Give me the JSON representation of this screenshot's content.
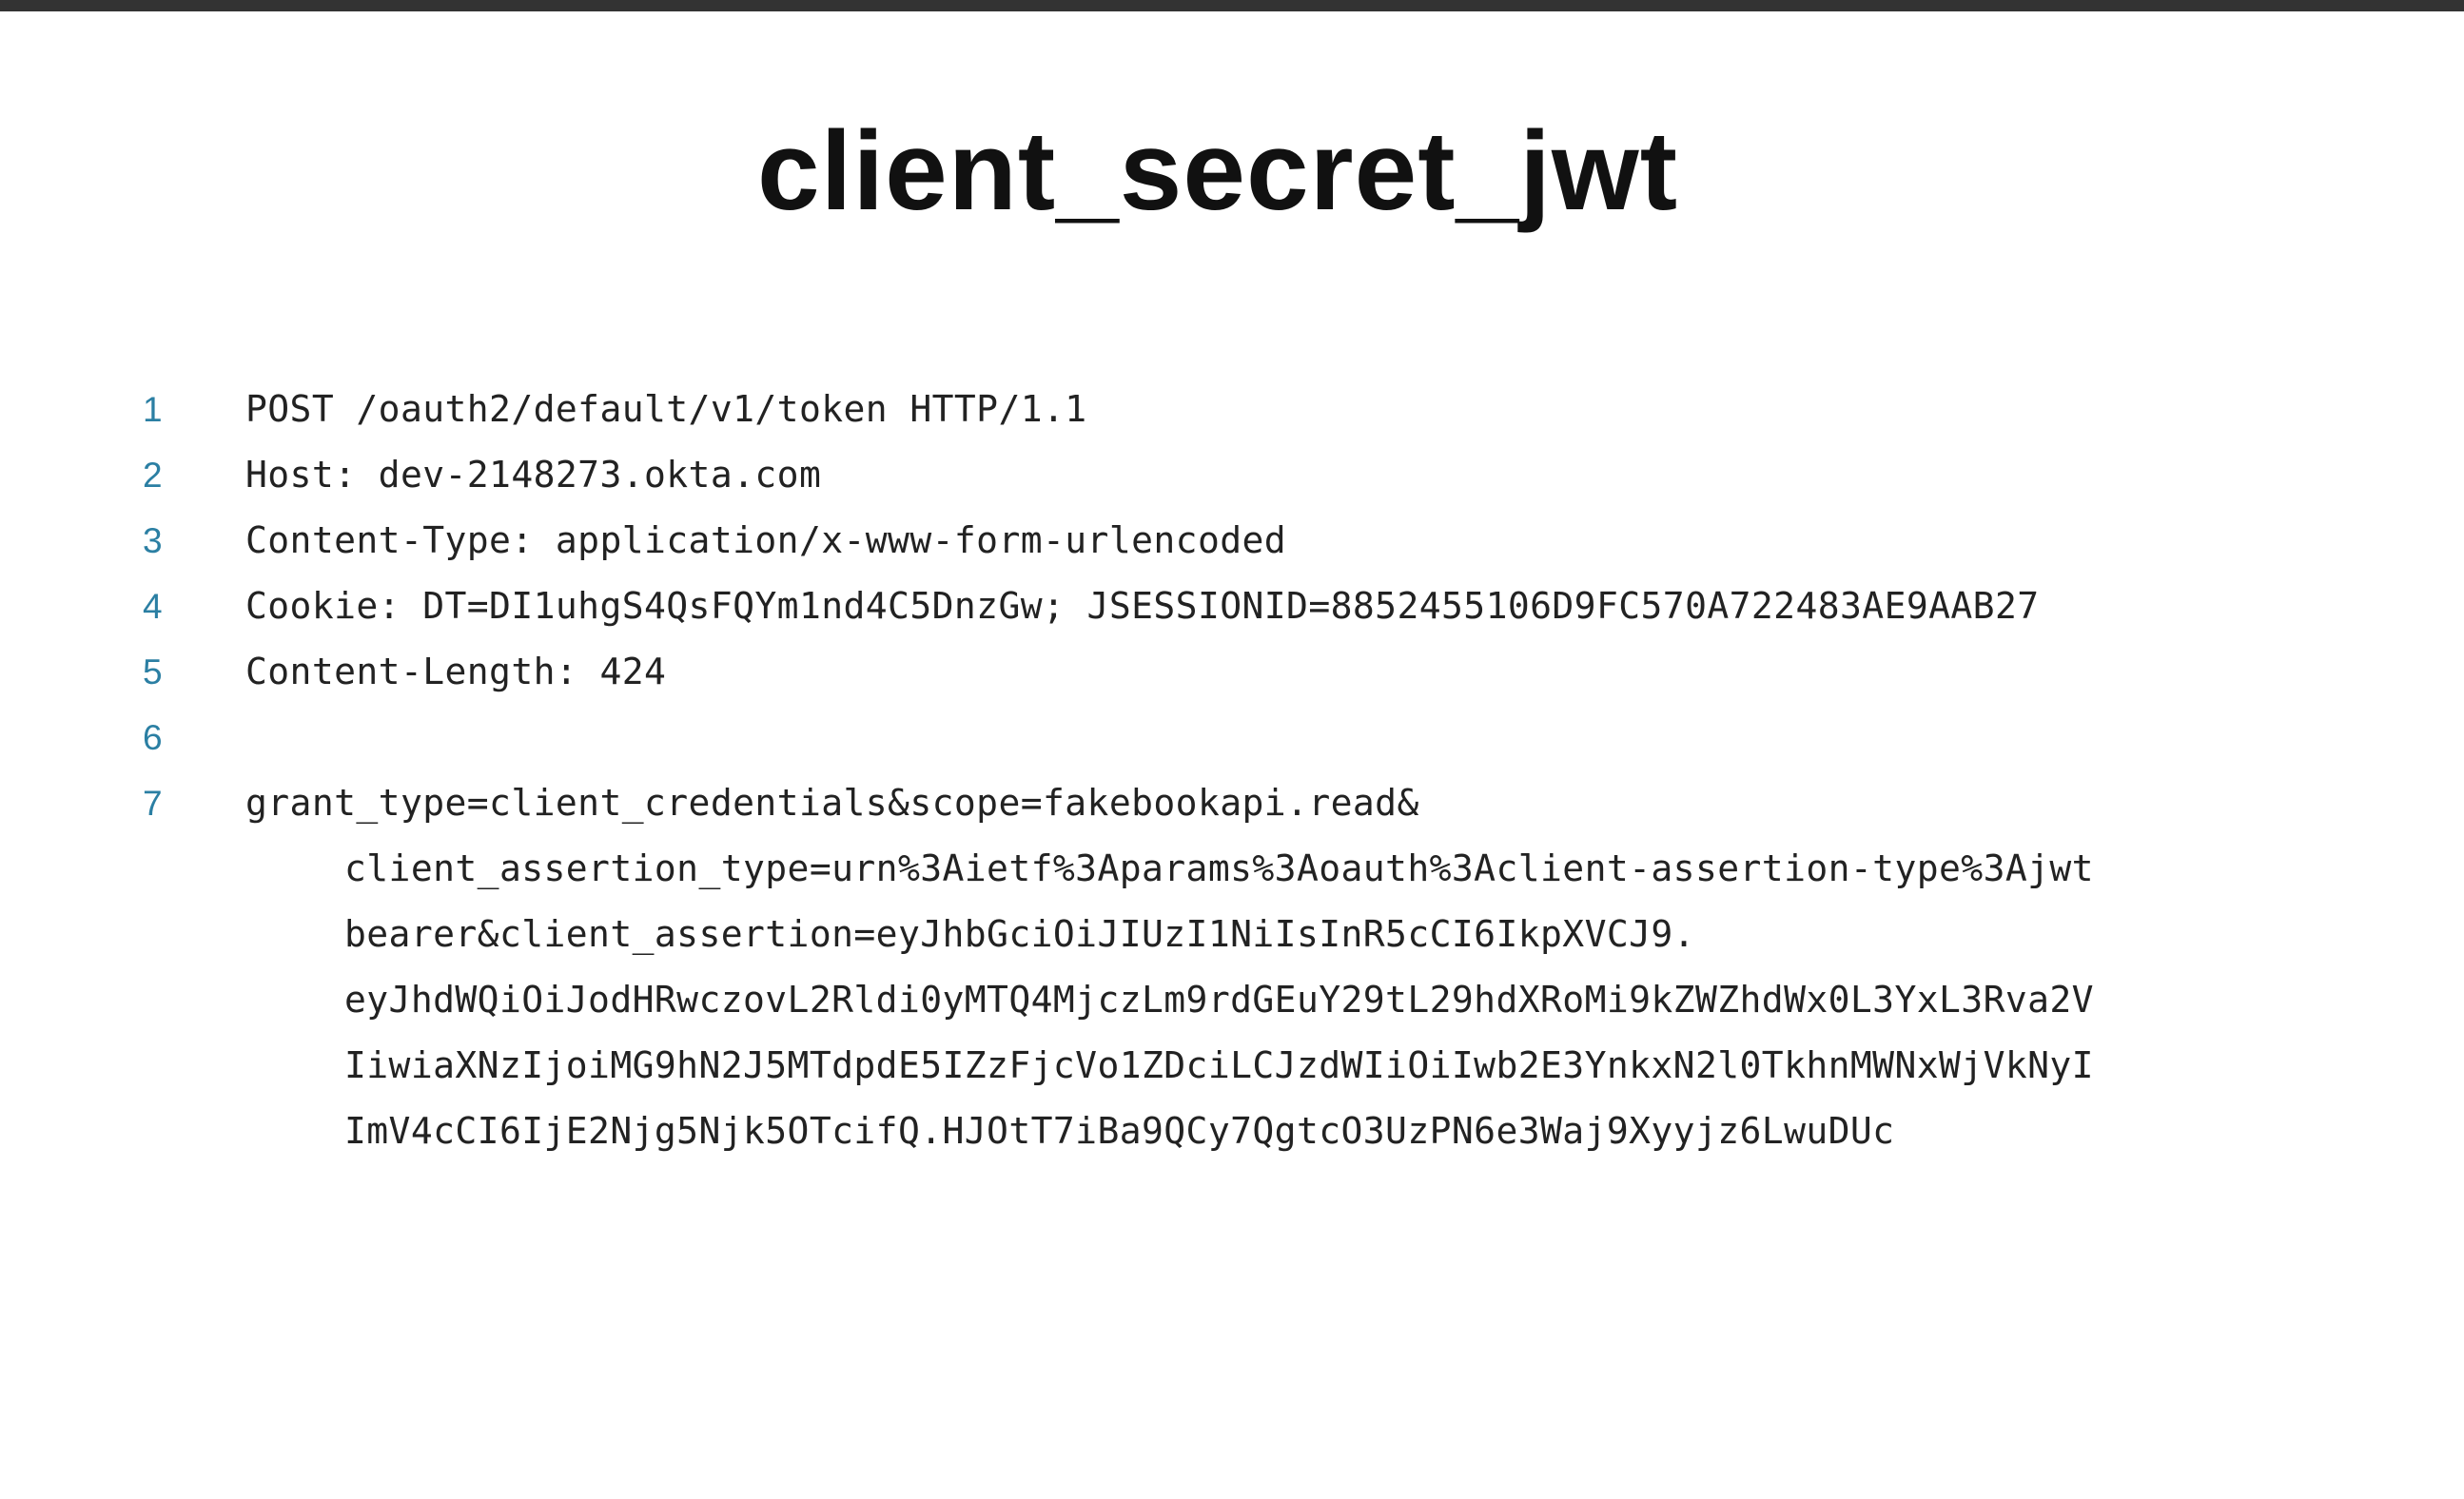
{
  "slide": {
    "title": "client_secret_jwt"
  },
  "code": {
    "lines": [
      {
        "number": "1",
        "text": "POST /oauth2/default/v1/token HTTP/1.1"
      },
      {
        "number": "2",
        "text": "Host: dev-2148273.okta.com"
      },
      {
        "number": "3",
        "text": "Content-Type: application/x-www-form-urlencoded"
      },
      {
        "number": "4",
        "text": "Cookie: DT=DI1uhgS4QsFQYm1nd4C5DnzGw; JSESSIONID=8852455106D9FC570A722483AE9AAB27"
      },
      {
        "number": "5",
        "text": "Content-Length: 424"
      },
      {
        "number": "6",
        "text": ""
      },
      {
        "number": "7",
        "text": "grant_type=client_credentials&scope=fakebookapi.read&"
      }
    ],
    "continuation": [
      "client_assertion_type=urn%3Aietf%3Aparams%3Aoauth%3Aclient-assertion-type%3Ajwt",
      "bearer&client_assertion=eyJhbGciOiJIUzI1NiIsInR5cCI6IkpXVCJ9.",
      "eyJhdWQiOiJodHRwczovL2Rldi0yMTQ4MjczLm9rdGEuY29tL29hdXRoMi9kZWZhdWx0L3YxL3Rva2V",
      "IiwiaXNzIjoiMG9hN2J5MTdpdE5IZzFjcVo1ZDciLCJzdWIiOiIwb2E3YnkxN2l0TkhnMWNxWjVkNyI",
      "ImV4cCI6IjE2Njg5Njk5OTcifQ.HJOtT7iBa9QCy7QgtcO3UzPN6e3Waj9Xyyjz6LwuDUc"
    ]
  }
}
